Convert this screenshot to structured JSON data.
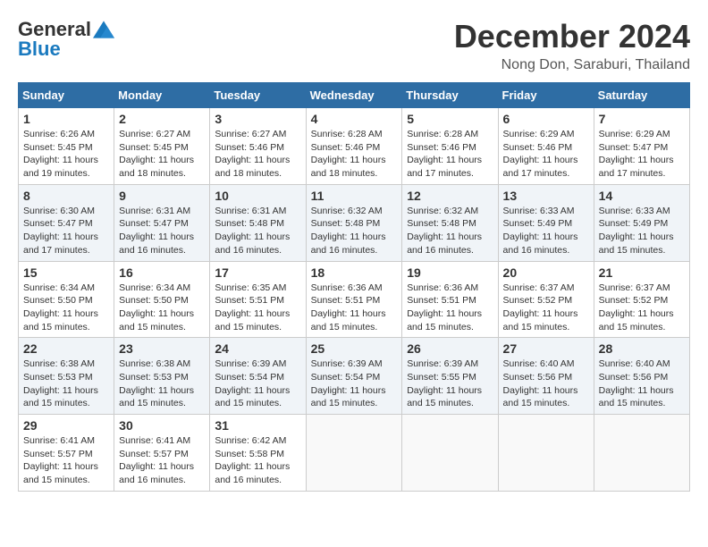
{
  "header": {
    "logo_general": "General",
    "logo_blue": "Blue",
    "month_year": "December 2024",
    "location": "Nong Don, Saraburi, Thailand"
  },
  "weekdays": [
    "Sunday",
    "Monday",
    "Tuesday",
    "Wednesday",
    "Thursday",
    "Friday",
    "Saturday"
  ],
  "weeks": [
    [
      {
        "day": "1",
        "detail": "Sunrise: 6:26 AM\nSunset: 5:45 PM\nDaylight: 11 hours and 19 minutes."
      },
      {
        "day": "2",
        "detail": "Sunrise: 6:27 AM\nSunset: 5:45 PM\nDaylight: 11 hours and 18 minutes."
      },
      {
        "day": "3",
        "detail": "Sunrise: 6:27 AM\nSunset: 5:46 PM\nDaylight: 11 hours and 18 minutes."
      },
      {
        "day": "4",
        "detail": "Sunrise: 6:28 AM\nSunset: 5:46 PM\nDaylight: 11 hours and 18 minutes."
      },
      {
        "day": "5",
        "detail": "Sunrise: 6:28 AM\nSunset: 5:46 PM\nDaylight: 11 hours and 17 minutes."
      },
      {
        "day": "6",
        "detail": "Sunrise: 6:29 AM\nSunset: 5:46 PM\nDaylight: 11 hours and 17 minutes."
      },
      {
        "day": "7",
        "detail": "Sunrise: 6:29 AM\nSunset: 5:47 PM\nDaylight: 11 hours and 17 minutes."
      }
    ],
    [
      {
        "day": "8",
        "detail": "Sunrise: 6:30 AM\nSunset: 5:47 PM\nDaylight: 11 hours and 17 minutes."
      },
      {
        "day": "9",
        "detail": "Sunrise: 6:31 AM\nSunset: 5:47 PM\nDaylight: 11 hours and 16 minutes."
      },
      {
        "day": "10",
        "detail": "Sunrise: 6:31 AM\nSunset: 5:48 PM\nDaylight: 11 hours and 16 minutes."
      },
      {
        "day": "11",
        "detail": "Sunrise: 6:32 AM\nSunset: 5:48 PM\nDaylight: 11 hours and 16 minutes."
      },
      {
        "day": "12",
        "detail": "Sunrise: 6:32 AM\nSunset: 5:48 PM\nDaylight: 11 hours and 16 minutes."
      },
      {
        "day": "13",
        "detail": "Sunrise: 6:33 AM\nSunset: 5:49 PM\nDaylight: 11 hours and 16 minutes."
      },
      {
        "day": "14",
        "detail": "Sunrise: 6:33 AM\nSunset: 5:49 PM\nDaylight: 11 hours and 15 minutes."
      }
    ],
    [
      {
        "day": "15",
        "detail": "Sunrise: 6:34 AM\nSunset: 5:50 PM\nDaylight: 11 hours and 15 minutes."
      },
      {
        "day": "16",
        "detail": "Sunrise: 6:34 AM\nSunset: 5:50 PM\nDaylight: 11 hours and 15 minutes."
      },
      {
        "day": "17",
        "detail": "Sunrise: 6:35 AM\nSunset: 5:51 PM\nDaylight: 11 hours and 15 minutes."
      },
      {
        "day": "18",
        "detail": "Sunrise: 6:36 AM\nSunset: 5:51 PM\nDaylight: 11 hours and 15 minutes."
      },
      {
        "day": "19",
        "detail": "Sunrise: 6:36 AM\nSunset: 5:51 PM\nDaylight: 11 hours and 15 minutes."
      },
      {
        "day": "20",
        "detail": "Sunrise: 6:37 AM\nSunset: 5:52 PM\nDaylight: 11 hours and 15 minutes."
      },
      {
        "day": "21",
        "detail": "Sunrise: 6:37 AM\nSunset: 5:52 PM\nDaylight: 11 hours and 15 minutes."
      }
    ],
    [
      {
        "day": "22",
        "detail": "Sunrise: 6:38 AM\nSunset: 5:53 PM\nDaylight: 11 hours and 15 minutes."
      },
      {
        "day": "23",
        "detail": "Sunrise: 6:38 AM\nSunset: 5:53 PM\nDaylight: 11 hours and 15 minutes."
      },
      {
        "day": "24",
        "detail": "Sunrise: 6:39 AM\nSunset: 5:54 PM\nDaylight: 11 hours and 15 minutes."
      },
      {
        "day": "25",
        "detail": "Sunrise: 6:39 AM\nSunset: 5:54 PM\nDaylight: 11 hours and 15 minutes."
      },
      {
        "day": "26",
        "detail": "Sunrise: 6:39 AM\nSunset: 5:55 PM\nDaylight: 11 hours and 15 minutes."
      },
      {
        "day": "27",
        "detail": "Sunrise: 6:40 AM\nSunset: 5:56 PM\nDaylight: 11 hours and 15 minutes."
      },
      {
        "day": "28",
        "detail": "Sunrise: 6:40 AM\nSunset: 5:56 PM\nDaylight: 11 hours and 15 minutes."
      }
    ],
    [
      {
        "day": "29",
        "detail": "Sunrise: 6:41 AM\nSunset: 5:57 PM\nDaylight: 11 hours and 15 minutes."
      },
      {
        "day": "30",
        "detail": "Sunrise: 6:41 AM\nSunset: 5:57 PM\nDaylight: 11 hours and 16 minutes."
      },
      {
        "day": "31",
        "detail": "Sunrise: 6:42 AM\nSunset: 5:58 PM\nDaylight: 11 hours and 16 minutes."
      },
      {
        "day": "",
        "detail": ""
      },
      {
        "day": "",
        "detail": ""
      },
      {
        "day": "",
        "detail": ""
      },
      {
        "day": "",
        "detail": ""
      }
    ]
  ]
}
